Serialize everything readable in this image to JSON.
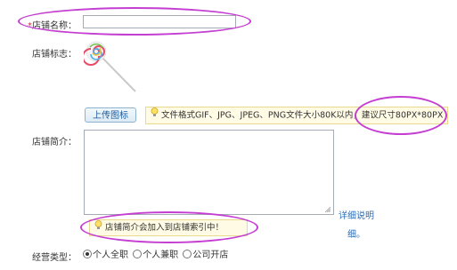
{
  "form": {
    "shop_name_required_mark": "*",
    "shop_name_label": "店铺名称：",
    "shop_name_value": "",
    "shop_logo_label": "店铺标志：",
    "upload_button_label": "上传图标",
    "upload_tip_text": "文件格式GIF、JPG、JPEG、PNG文件大小80K以内，建议尺寸80PX*80PX",
    "shop_desc_label": "店铺简介：",
    "shop_desc_value": "",
    "detail_link_line1": "详细说明",
    "detail_link_line2": "细。",
    "desc_tip_text": "店铺简介会加入到店铺索引中！",
    "business_type_label": "经营类型：",
    "business_type_options": [
      "个人全职",
      "个人兼职",
      "公司开店"
    ],
    "business_type_selected": "个人全职"
  },
  "colors": {
    "annotation_ellipse": "#c43ed1",
    "tip_background": "#fffbe5",
    "tip_border": "#e9d98c",
    "link": "#2d6db5",
    "button_text": "#1c5a9a"
  },
  "icons": [
    "lightbulb-icon",
    "lollipop-logo",
    "resize-grip-icon"
  ]
}
